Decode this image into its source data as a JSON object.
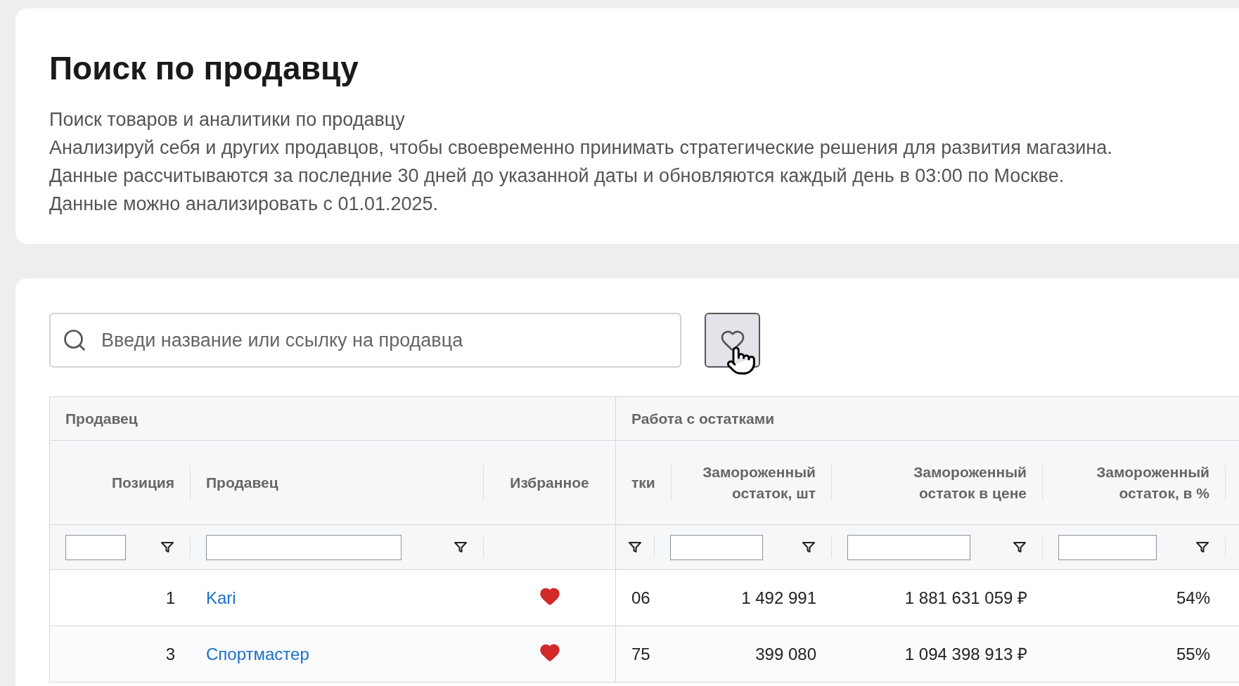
{
  "page": {
    "title": "Поиск по продавцу",
    "description": [
      "Поиск товаров и аналитики по продавцу",
      "Анализируй себя и других продавцов, чтобы своевременно принимать стратегические решения для развития магазина.",
      "Данные рассчитываются за последние 30 дней до указанной даты и обновляются каждый день в 03:00 по Москве.",
      "Данные можно анализировать с 01.01.2025."
    ]
  },
  "search": {
    "placeholder": "Введи название или ссылку на продавца"
  },
  "favorites_button": {
    "hovered": true
  },
  "table": {
    "groups": [
      {
        "label": "Продавец"
      },
      {
        "label": "Работа с остатками"
      }
    ],
    "columns": [
      {
        "label": "Позиция",
        "kind": "number",
        "filter_field": true,
        "filter_button": true
      },
      {
        "label": "Продавец",
        "kind": "link",
        "filter_field": true,
        "filter_button": true
      },
      {
        "label": "Избранное",
        "kind": "favorite",
        "filter_field": false,
        "filter_button": false
      },
      {
        "label": "тки",
        "kind": "number",
        "filter_field": false,
        "filter_button": true
      },
      {
        "label": "Замороженный остаток, шт",
        "kind": "number",
        "filter_field": true,
        "filter_button": true
      },
      {
        "label": "Замороженный остаток в цене",
        "kind": "number",
        "filter_field": true,
        "filter_button": true
      },
      {
        "label": "Замороженный остаток, в %",
        "kind": "number",
        "filter_field": true,
        "filter_button": true
      }
    ],
    "rows": [
      {
        "cells": [
          "1",
          "Kari",
          true,
          "06",
          "1 492 991",
          "1 881 631 059 ₽",
          "54%"
        ]
      },
      {
        "cells": [
          "3",
          "Спортмастер",
          true,
          "75",
          "399 080",
          "1 094 398 913 ₽",
          "55%"
        ]
      }
    ]
  }
}
